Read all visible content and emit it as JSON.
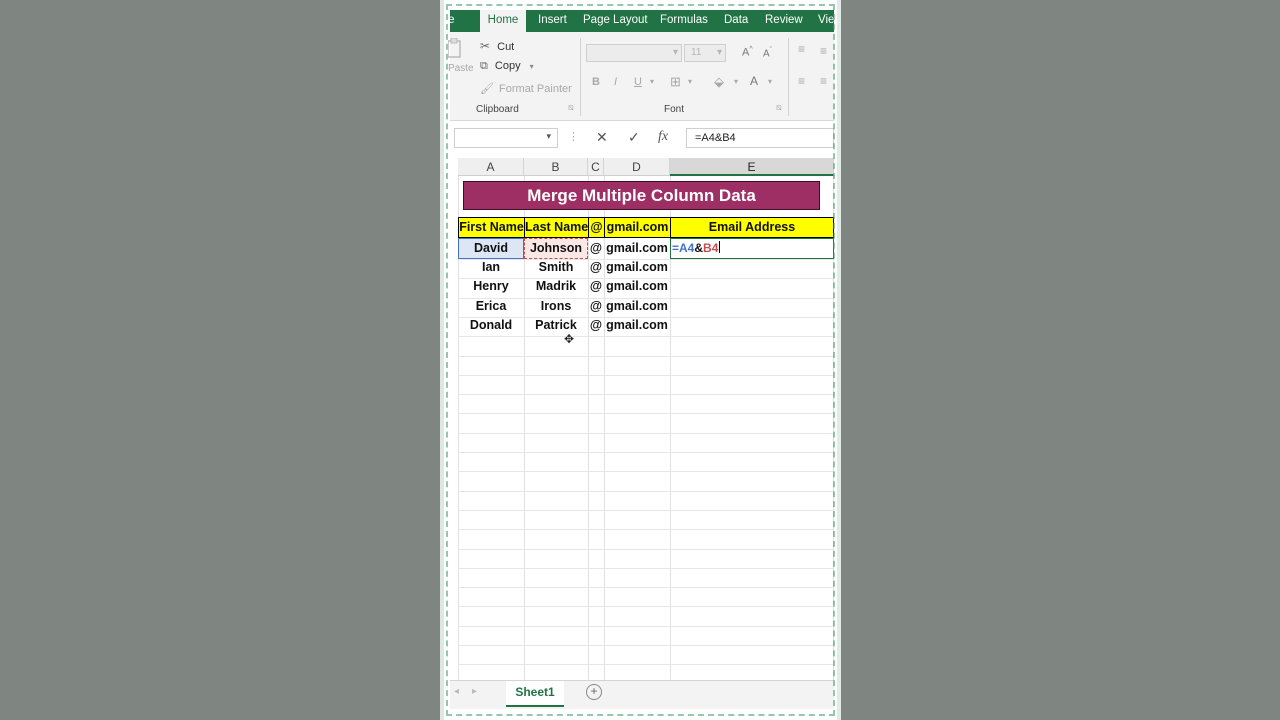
{
  "ribbon_tabs": [
    "File",
    "Home",
    "Insert",
    "Page Layout",
    "Formulas",
    "Data",
    "Review",
    "View"
  ],
  "active_tab": "Home",
  "clipboard": {
    "paste_label": "Paste",
    "cut": "Cut",
    "copy": "Copy",
    "format_painter": "Format Painter",
    "group_label": "Clipboard"
  },
  "font": {
    "size": "11",
    "bold": "B",
    "italic": "I",
    "underline": "U",
    "grow": "A",
    "shrink": "A",
    "color": "A",
    "group_label": "Font"
  },
  "formula_bar": {
    "cancel": "✕",
    "enter": "✓",
    "fx": "fx",
    "formula": "=A4&B4"
  },
  "columns": [
    "A",
    "B",
    "C",
    "D",
    "E"
  ],
  "selected_column": "E",
  "sheet": {
    "title": "Merge Multiple Column Data",
    "headers": [
      "First Name",
      "Last Name",
      "@",
      "gmail.com",
      "Email Address"
    ],
    "rows": [
      [
        "David",
        "Johnson",
        "@",
        "gmail.com",
        ""
      ],
      [
        "Ian",
        "Smith",
        "@",
        "gmail.com",
        ""
      ],
      [
        "Henry",
        "Madrik",
        "@",
        "gmail.com",
        ""
      ],
      [
        "Erica",
        "Irons",
        "@",
        "gmail.com",
        ""
      ],
      [
        "Donald",
        "Patrick",
        "@",
        "gmail.com",
        ""
      ]
    ],
    "editing_cell": {
      "ref_a": "=A4",
      "amp": "&",
      "ref_b": "B4"
    }
  },
  "sheet_tabs": [
    "Sheet1"
  ],
  "add_sheet": "+",
  "colors": {
    "excel_green": "#217346",
    "title_fill": "#9d2f64",
    "header_fill": "#ffff00",
    "ref_blue": "#4472c4",
    "ref_red": "#c0504d"
  }
}
